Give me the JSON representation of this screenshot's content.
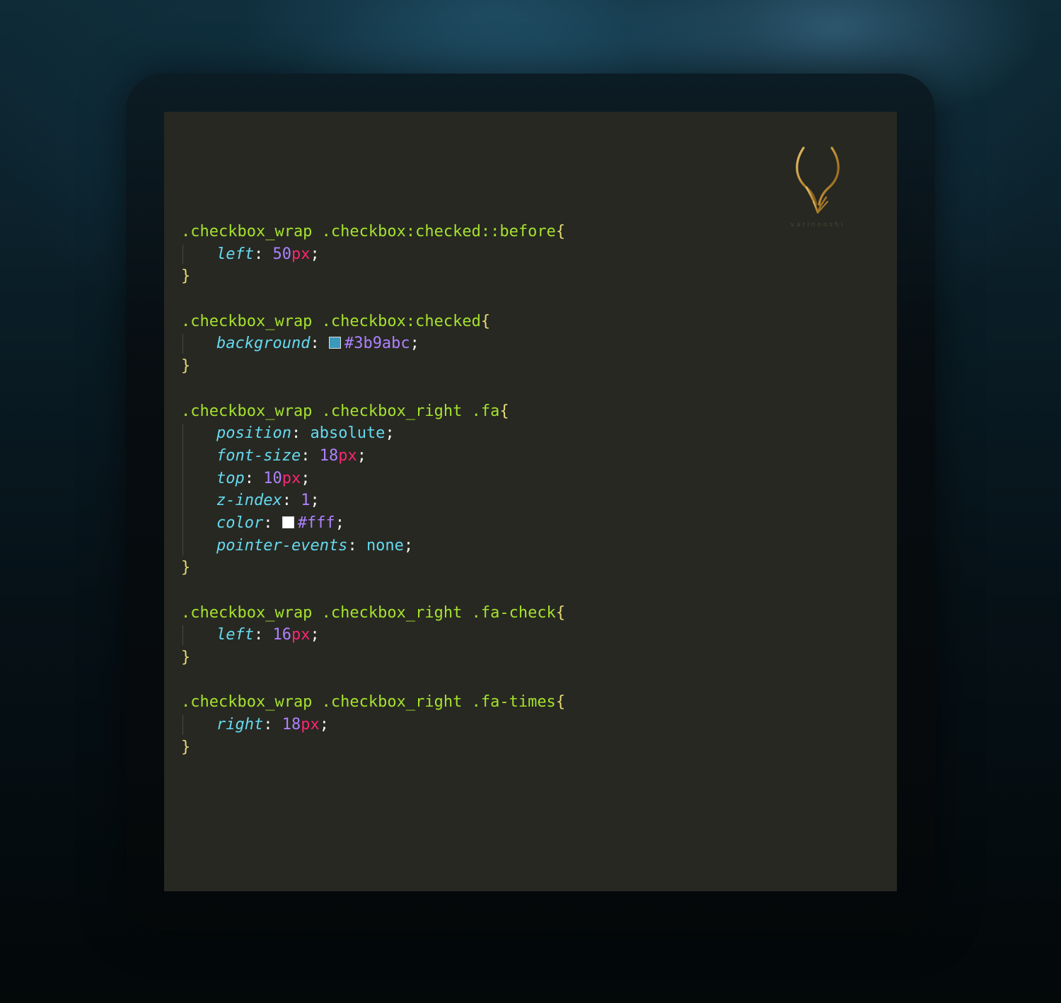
{
  "logo": {
    "text": "varinooshi",
    "color": "#c9a24a"
  },
  "blocks": [
    {
      "selector": ".checkbox_wrap .checkbox:checked::before",
      "open": "{",
      "close": "}",
      "decls": [
        {
          "prop": "left",
          "colon": ": ",
          "num": "50",
          "unit": "px",
          "semi": ";"
        }
      ]
    },
    {
      "selector": ".checkbox_wrap .checkbox:checked",
      "open": "{",
      "close": "}",
      "decls": [
        {
          "prop": "background",
          "colon": ": ",
          "swatch": "#3b9abc",
          "num": "#3b9abc",
          "semi": ";"
        }
      ]
    },
    {
      "selector": ".checkbox_wrap .checkbox_right .fa",
      "open": "{",
      "close": "}",
      "decls": [
        {
          "prop": "position",
          "colon": ": ",
          "kw": "absolute",
          "semi": ";"
        },
        {
          "prop": "font-size",
          "colon": ": ",
          "num": "18",
          "unit": "px",
          "semi": ";"
        },
        {
          "prop": "top",
          "colon": ": ",
          "num": "10",
          "unit": "px",
          "semi": ";"
        },
        {
          "prop": "z-index",
          "colon": ": ",
          "num": "1",
          "semi": ";"
        },
        {
          "prop": "color",
          "colon": ": ",
          "swatch": "#ffffff",
          "num": "#fff",
          "semi": ";"
        },
        {
          "prop": "pointer-events",
          "colon": ": ",
          "kw": "none",
          "semi": ";"
        }
      ]
    },
    {
      "selector": ".checkbox_wrap .checkbox_right .fa-check",
      "open": "{",
      "close": "}",
      "decls": [
        {
          "prop": "left",
          "colon": ": ",
          "num": "16",
          "unit": "px",
          "semi": ";"
        }
      ]
    },
    {
      "selector": ".checkbox_wrap .checkbox_right .fa-times",
      "open": "{",
      "close": "}",
      "decls": [
        {
          "prop": "right",
          "colon": ": ",
          "num": "18",
          "unit": "px",
          "semi": ";"
        }
      ]
    }
  ],
  "colors": {
    "editor_bg": "#272822",
    "selector": "#a6e22e",
    "brace": "#e6db74",
    "property": "#66d9ef",
    "number": "#ae81ff",
    "unit": "#f92672"
  }
}
